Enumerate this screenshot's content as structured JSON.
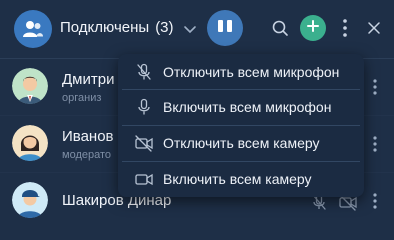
{
  "header": {
    "title": "Подключены",
    "count": "(3)",
    "icons": {
      "group": "group-icon",
      "chevron": "chevron-down-icon",
      "layout": "layout-split-icon",
      "search": "search-icon",
      "add": "plus-icon",
      "more": "more-vertical-icon",
      "close": "close-icon"
    }
  },
  "participants": [
    {
      "name": "Дмитри",
      "role": "организ",
      "avatar": "avatar-man-suit"
    },
    {
      "name": "Иванов",
      "role": "модерато",
      "avatar": "avatar-woman"
    },
    {
      "name": "Шакиров Динар",
      "role": "",
      "avatar": "avatar-man-cap"
    }
  ],
  "menu": {
    "items": [
      {
        "label": "Отключить всем микрофон",
        "icon": "mic-off-icon"
      },
      {
        "label": "Включить всем микрофон",
        "icon": "mic-icon"
      },
      {
        "label": "Отключить всем камеру",
        "icon": "camera-off-icon"
      },
      {
        "label": "Включить всем камеру",
        "icon": "camera-icon"
      }
    ]
  },
  "colors": {
    "background": "#1e2f47",
    "menu": "#1b2b42",
    "accent_blue": "#3f78b8",
    "accent_green": "#3bb08e",
    "muted_text": "#7f8fa6"
  }
}
